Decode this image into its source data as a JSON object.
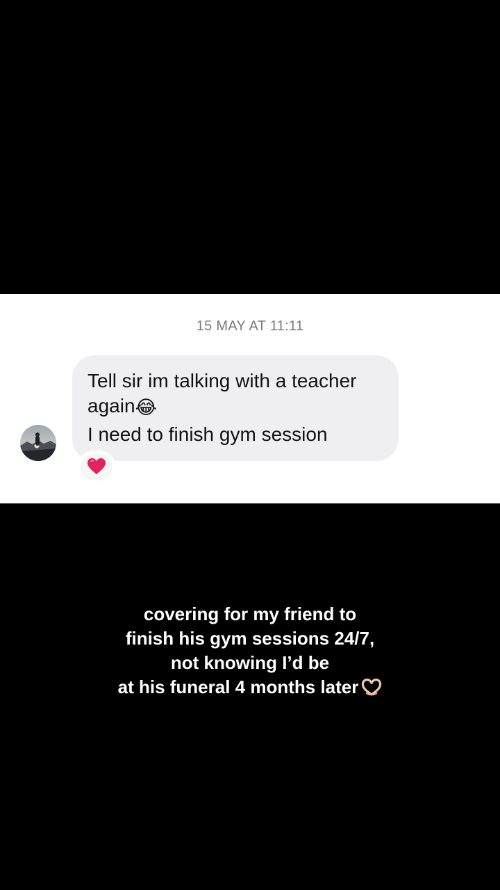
{
  "chat": {
    "timestamp": "15 MAY AT 11:11",
    "message": {
      "line1": "Tell sir im talking with a teacher",
      "line2": "again",
      "line2_emoji": "😂",
      "line3": "I need to finish gym session"
    },
    "reaction": {
      "icon": "red-heart-icon",
      "color": "#e0245e"
    },
    "avatar_icon": "profile-photo"
  },
  "caption": {
    "line1": "covering for my friend to",
    "line2": "finish his gym sessions 24/7,",
    "line3": "not knowing I’d be",
    "line4": "at his funeral 4 months later",
    "trailing_icon": "heart-hands-icon"
  },
  "colors": {
    "background": "#000000",
    "panel": "#ffffff",
    "bubble": "#efeff1",
    "timestamp": "#7a7a7a",
    "caption": "#ffffff"
  }
}
